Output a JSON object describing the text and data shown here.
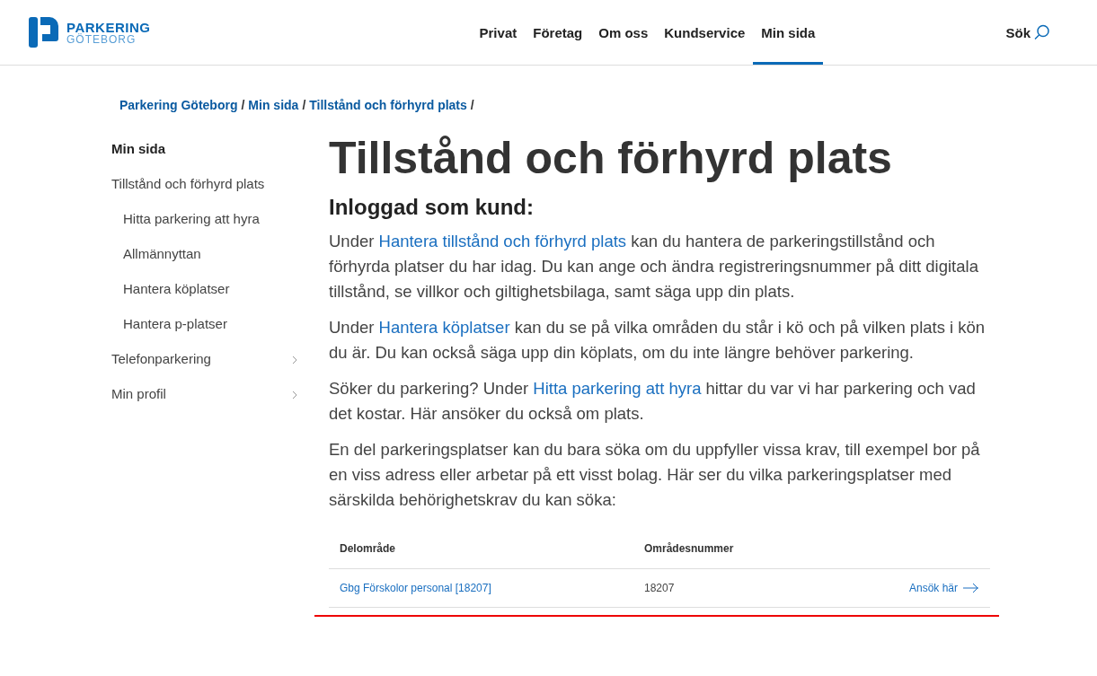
{
  "logo": {
    "line1": "PARKERING",
    "line2": "GÖTEBORG"
  },
  "nav": [
    {
      "label": "Privat",
      "selected": false
    },
    {
      "label": "Företag",
      "selected": false
    },
    {
      "label": "Om oss",
      "selected": false
    },
    {
      "label": "Kundservice",
      "selected": false
    },
    {
      "label": "Min sida",
      "selected": true
    }
  ],
  "search": {
    "label": "Sök"
  },
  "breadcrumb": [
    {
      "label": "Parkering Göteborg",
      "separator": "/"
    },
    {
      "label": "Min sida",
      "separator": "/"
    },
    {
      "label": "Tillstånd och förhyrd plats",
      "separator": "/"
    }
  ],
  "sidebar": {
    "heading": "Min sida",
    "items": [
      {
        "label": "Tillstånd och förhyrd plats",
        "expandable": false,
        "children": [
          {
            "label": "Hitta parkering att hyra"
          },
          {
            "label": "Allmännyttan"
          },
          {
            "label": "Hantera köplatser"
          },
          {
            "label": "Hantera p-platser"
          }
        ]
      },
      {
        "label": "Telefonparkering",
        "expandable": true
      },
      {
        "label": "Min profil",
        "expandable": true
      }
    ]
  },
  "title": "Tillstånd och förhyrd plats",
  "subtitle": "Inloggad som kund:",
  "paragraphs": [
    [
      {
        "text": "Under "
      },
      {
        "text": "Hantera tillstånd och förhyrd plats",
        "link": true
      },
      {
        "text": " kan du hantera de parkeringstillstånd och förhyrda platser du har idag. Du kan ange och ändra registreringsnummer på ditt digitala tillstånd, se villkor och giltighetsbilaga, samt säga upp din plats."
      }
    ],
    [
      {
        "text": "Under "
      },
      {
        "text": "Hantera köplatser",
        "link": true
      },
      {
        "text": " kan du se på vilka områden du står i kö och på vilken plats i kön du är. Du kan också säga upp din köplats, om du inte längre behöver parkering."
      }
    ],
    [
      {
        "text": "Söker du parkering? Under "
      },
      {
        "text": "Hitta parkering att hyra",
        "link": true
      },
      {
        "text": " hittar du var vi har parkering och vad det kostar. Här ansöker du också om plats."
      }
    ],
    [
      {
        "text": "En del parkeringsplatser kan du bara söka om du uppfyller vissa krav, till exempel bor på en viss adress eller arbetar på ett visst bolag. Här ser du vilka parkeringsplatser med särskilda behörighetskrav du kan söka:"
      }
    ]
  ],
  "table": {
    "columns": [
      "Delområde",
      "Områdesnummer"
    ],
    "rows": [
      {
        "area": "Gbg Förskolor personal [18207]",
        "number": "18207",
        "action": "Ansök här"
      }
    ]
  }
}
